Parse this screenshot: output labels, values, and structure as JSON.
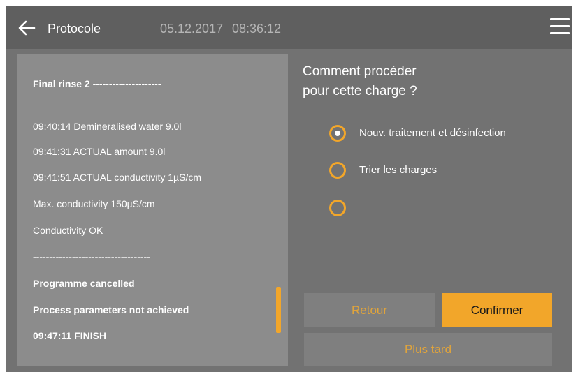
{
  "header": {
    "title": "Protocole",
    "date": "05.12.2017",
    "time": "08:36:12"
  },
  "log": {
    "lines": [
      {
        "text": "Final rinse 2 ---------------------",
        "bold": true
      },
      {
        "text": "09:40:14 Demineralised water 9.0l",
        "bold": false
      },
      {
        "text": "09:41:31 ACTUAL amount 9.0l",
        "bold": false
      },
      {
        "text": "09:41:51 ACTUAL conductivity 1µS/cm",
        "bold": false
      },
      {
        "text": "Max. conductivity 150µS/cm",
        "bold": false
      },
      {
        "text": "Conductivity OK",
        "bold": false
      },
      {
        "text": "------------------------------------",
        "bold": true
      },
      {
        "text": "Programme cancelled",
        "bold": true
      },
      {
        "text": "Process parameters not achieved",
        "bold": true
      },
      {
        "text": "09:47:11 FINISH",
        "bold": true
      }
    ]
  },
  "question": {
    "line1": "Comment procéder",
    "line2": "pour cette charge ?"
  },
  "options": [
    {
      "label": "Nouv. traitement et désinfection",
      "selected": true
    },
    {
      "label": "Trier les charges",
      "selected": false
    },
    {
      "label": "",
      "selected": false
    }
  ],
  "custom_field": {
    "value": ""
  },
  "buttons": {
    "back": "Retour",
    "confirm": "Confirmer",
    "later": "Plus tard"
  },
  "colors": {
    "accent": "#f2a62a",
    "header_bg": "#5f5f5f",
    "panel_bg": "#8c8c8c",
    "screen_bg": "#727272"
  }
}
